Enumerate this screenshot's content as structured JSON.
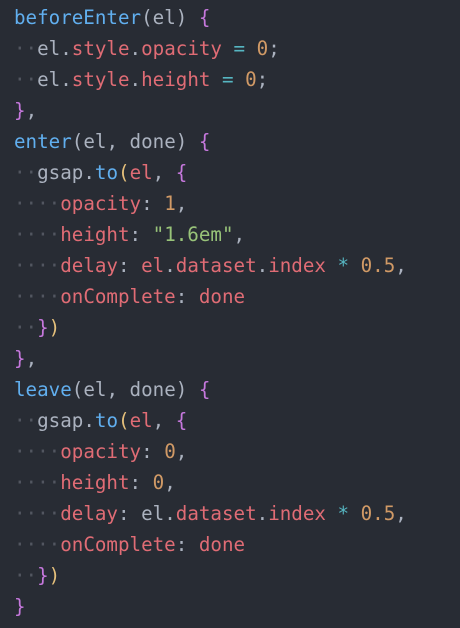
{
  "colors": {
    "background": "#282c34",
    "function": "#61afef",
    "property": "#e06c75",
    "number": "#d19a66",
    "string": "#98c379",
    "operator": "#56b6c2",
    "bracket_level_1": "#c678dd",
    "bracket_level_2": "#e5c07b",
    "plain": "#abb2bf"
  },
  "code": {
    "lines": [
      {
        "indent": 0,
        "tokens": [
          {
            "t": "beforeEnter",
            "c": "fn"
          },
          {
            "t": "(",
            "c": "punc"
          },
          {
            "t": "el",
            "c": "var"
          },
          {
            "t": ") ",
            "c": "punc"
          },
          {
            "t": "{",
            "c": "brace1"
          }
        ]
      },
      {
        "indent": 1,
        "tokens": [
          {
            "t": "el",
            "c": "var"
          },
          {
            "t": ".",
            "c": "punc"
          },
          {
            "t": "style",
            "c": "prop"
          },
          {
            "t": ".",
            "c": "punc"
          },
          {
            "t": "opacity",
            "c": "prop"
          },
          {
            "t": " = ",
            "c": "eq"
          },
          {
            "t": "0",
            "c": "num"
          },
          {
            "t": ";",
            "c": "punc"
          }
        ]
      },
      {
        "indent": 1,
        "tokens": [
          {
            "t": "el",
            "c": "var"
          },
          {
            "t": ".",
            "c": "punc"
          },
          {
            "t": "style",
            "c": "prop"
          },
          {
            "t": ".",
            "c": "punc"
          },
          {
            "t": "height",
            "c": "prop"
          },
          {
            "t": " = ",
            "c": "eq"
          },
          {
            "t": "0",
            "c": "num"
          },
          {
            "t": ";",
            "c": "punc"
          }
        ]
      },
      {
        "indent": 0,
        "tokens": [
          {
            "t": "}",
            "c": "brace1"
          },
          {
            "t": ",",
            "c": "punc"
          }
        ]
      },
      {
        "indent": 0,
        "tokens": [
          {
            "t": "enter",
            "c": "fn"
          },
          {
            "t": "(",
            "c": "punc"
          },
          {
            "t": "el",
            "c": "var"
          },
          {
            "t": ", ",
            "c": "punc"
          },
          {
            "t": "done",
            "c": "var"
          },
          {
            "t": ") ",
            "c": "punc"
          },
          {
            "t": "{",
            "c": "brace1"
          }
        ]
      },
      {
        "indent": 1,
        "tokens": [
          {
            "t": "gsap",
            "c": "var"
          },
          {
            "t": ".",
            "c": "punc"
          },
          {
            "t": "to",
            "c": "fn"
          },
          {
            "t": "(",
            "c": "brace2"
          },
          {
            "t": "el",
            "c": "prop"
          },
          {
            "t": ", ",
            "c": "punc"
          },
          {
            "t": "{",
            "c": "brace1"
          }
        ]
      },
      {
        "indent": 2,
        "tokens": [
          {
            "t": "opacity",
            "c": "prop"
          },
          {
            "t": ": ",
            "c": "punc"
          },
          {
            "t": "1",
            "c": "num"
          },
          {
            "t": ",",
            "c": "punc"
          }
        ]
      },
      {
        "indent": 2,
        "tokens": [
          {
            "t": "height",
            "c": "prop"
          },
          {
            "t": ": ",
            "c": "punc"
          },
          {
            "t": "\"1.6em\"",
            "c": "str"
          },
          {
            "t": ",",
            "c": "punc"
          }
        ]
      },
      {
        "indent": 2,
        "tokens": [
          {
            "t": "delay",
            "c": "prop"
          },
          {
            "t": ": ",
            "c": "punc"
          },
          {
            "t": "el",
            "c": "prop"
          },
          {
            "t": ".",
            "c": "punc"
          },
          {
            "t": "dataset",
            "c": "prop"
          },
          {
            "t": ".",
            "c": "punc"
          },
          {
            "t": "index",
            "c": "prop"
          },
          {
            "t": " * ",
            "c": "op"
          },
          {
            "t": "0.5",
            "c": "num"
          },
          {
            "t": ",",
            "c": "punc"
          }
        ]
      },
      {
        "indent": 2,
        "tokens": [
          {
            "t": "onComplete",
            "c": "prop"
          },
          {
            "t": ": ",
            "c": "punc"
          },
          {
            "t": "done",
            "c": "prop"
          }
        ]
      },
      {
        "indent": 1,
        "tokens": [
          {
            "t": "}",
            "c": "brace1"
          },
          {
            "t": ")",
            "c": "brace2"
          }
        ]
      },
      {
        "indent": 0,
        "tokens": [
          {
            "t": "}",
            "c": "brace1"
          },
          {
            "t": ",",
            "c": "punc"
          }
        ]
      },
      {
        "indent": 0,
        "tokens": [
          {
            "t": "leave",
            "c": "fn"
          },
          {
            "t": "(",
            "c": "punc"
          },
          {
            "t": "el",
            "c": "var"
          },
          {
            "t": ", ",
            "c": "punc"
          },
          {
            "t": "done",
            "c": "var"
          },
          {
            "t": ") ",
            "c": "punc"
          },
          {
            "t": "{",
            "c": "brace1"
          }
        ]
      },
      {
        "indent": 1,
        "tokens": [
          {
            "t": "gsap",
            "c": "var"
          },
          {
            "t": ".",
            "c": "punc"
          },
          {
            "t": "to",
            "c": "fn"
          },
          {
            "t": "(",
            "c": "brace2"
          },
          {
            "t": "el",
            "c": "prop"
          },
          {
            "t": ", ",
            "c": "punc"
          },
          {
            "t": "{",
            "c": "brace1"
          }
        ]
      },
      {
        "indent": 2,
        "tokens": [
          {
            "t": "opacity",
            "c": "prop"
          },
          {
            "t": ": ",
            "c": "punc"
          },
          {
            "t": "0",
            "c": "num"
          },
          {
            "t": ",",
            "c": "punc"
          }
        ]
      },
      {
        "indent": 2,
        "tokens": [
          {
            "t": "height",
            "c": "prop"
          },
          {
            "t": ": ",
            "c": "punc"
          },
          {
            "t": "0",
            "c": "num"
          },
          {
            "t": ",",
            "c": "punc"
          }
        ]
      },
      {
        "indent": 2,
        "tokens": [
          {
            "t": "delay",
            "c": "prop"
          },
          {
            "t": ": ",
            "c": "punc"
          },
          {
            "t": "el",
            "c": "var"
          },
          {
            "t": ".",
            "c": "punc"
          },
          {
            "t": "dataset",
            "c": "prop"
          },
          {
            "t": ".",
            "c": "punc"
          },
          {
            "t": "index",
            "c": "prop"
          },
          {
            "t": " * ",
            "c": "op"
          },
          {
            "t": "0.5",
            "c": "num"
          },
          {
            "t": ",",
            "c": "punc"
          }
        ]
      },
      {
        "indent": 2,
        "tokens": [
          {
            "t": "onComplete",
            "c": "prop"
          },
          {
            "t": ": ",
            "c": "punc"
          },
          {
            "t": "done",
            "c": "prop"
          }
        ]
      },
      {
        "indent": 1,
        "tokens": [
          {
            "t": "}",
            "c": "brace1"
          },
          {
            "t": ")",
            "c": "brace2"
          }
        ]
      },
      {
        "indent": 0,
        "tokens": [
          {
            "t": "}",
            "c": "brace1"
          }
        ]
      }
    ]
  }
}
